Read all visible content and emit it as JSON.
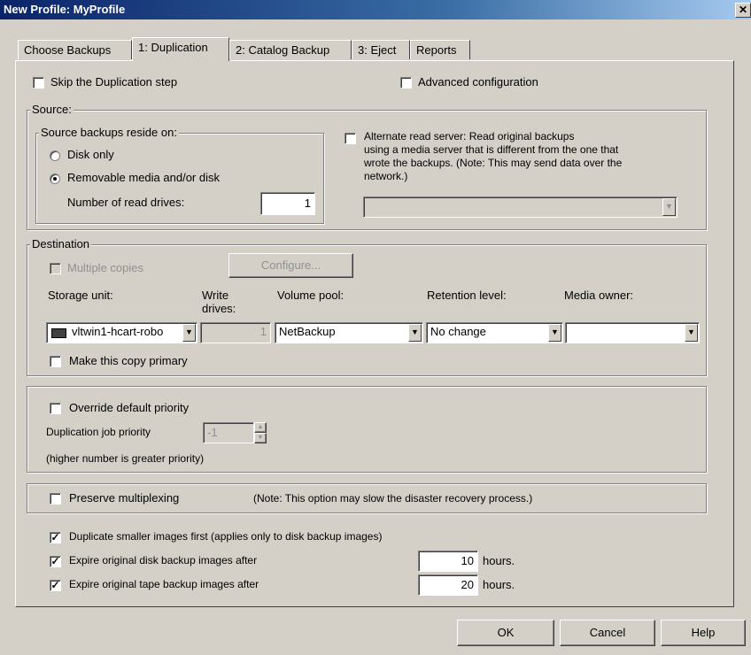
{
  "window": {
    "title": "New Profile: MyProfile",
    "close_glyph": "✕"
  },
  "tabs": [
    {
      "label": "Choose Backups",
      "active": false
    },
    {
      "label": "1: Duplication",
      "active": true
    },
    {
      "label": "2: Catalog Backup",
      "active": false
    },
    {
      "label": "3: Eject",
      "active": false
    },
    {
      "label": "Reports",
      "active": false
    }
  ],
  "top_options": {
    "skip_duplication": {
      "label": "Skip the Duplication step",
      "checked": false
    },
    "advanced_config": {
      "label": "Advanced configuration",
      "checked": false
    }
  },
  "source": {
    "legend": "Source:",
    "reside_legend": "Source backups reside on:",
    "disk_only": {
      "label": "Disk only",
      "selected": false
    },
    "removable": {
      "label": "Removable media and/or disk",
      "selected": true
    },
    "read_drives_label": "Number of read drives:",
    "read_drives_value": "1",
    "alternate_read": {
      "checked": false,
      "line1": "Alternate read server: Read original backups",
      "line2": "using a media server that is different from the one that",
      "line3": "wrote the backups. (Note: This may send data over the",
      "line4": "network.)"
    },
    "alternate_server_value": ""
  },
  "destination": {
    "legend": "Destination",
    "multiple_copies": {
      "label": "Multiple copies",
      "checked": false,
      "enabled": false
    },
    "configure_label": "Configure...",
    "headers": {
      "storage_unit": "Storage unit:",
      "write_drives_1": "Write",
      "write_drives_2": "drives:",
      "volume_pool": "Volume pool:",
      "retention_level": "Retention level:",
      "media_owner": "Media owner:"
    },
    "storage_unit_value": "vltwin1-hcart-robo",
    "write_drives_value": "1",
    "volume_pool_value": "NetBackup",
    "retention_value": "No change",
    "media_owner_value": "",
    "make_primary": {
      "label": "Make this copy primary",
      "checked": false
    }
  },
  "priority": {
    "override": {
      "label": "Override default priority",
      "checked": false
    },
    "job_priority_label": "Duplication job priority",
    "job_priority_value": "-1",
    "note": "(higher number is greater priority)"
  },
  "multiplexing": {
    "label": "Preserve multiplexing",
    "checked": false,
    "note": "(Note: This option may slow the disaster recovery process.)"
  },
  "bottom_options": {
    "smaller_first": {
      "label": "Duplicate smaller images first (applies only to disk backup images)",
      "checked": true
    },
    "expire_disk": {
      "label": "Expire original disk backup images after",
      "checked": true,
      "value": "10",
      "unit": "hours."
    },
    "expire_tape": {
      "label": "Expire original tape backup images after",
      "checked": true,
      "value": "20",
      "unit": "hours."
    }
  },
  "buttons": {
    "ok": "OK",
    "cancel": "Cancel",
    "help": "Help"
  },
  "glyphs": {
    "check": "✓",
    "dropdown": "▼",
    "spin_up": "▲",
    "spin_down": "▼"
  }
}
